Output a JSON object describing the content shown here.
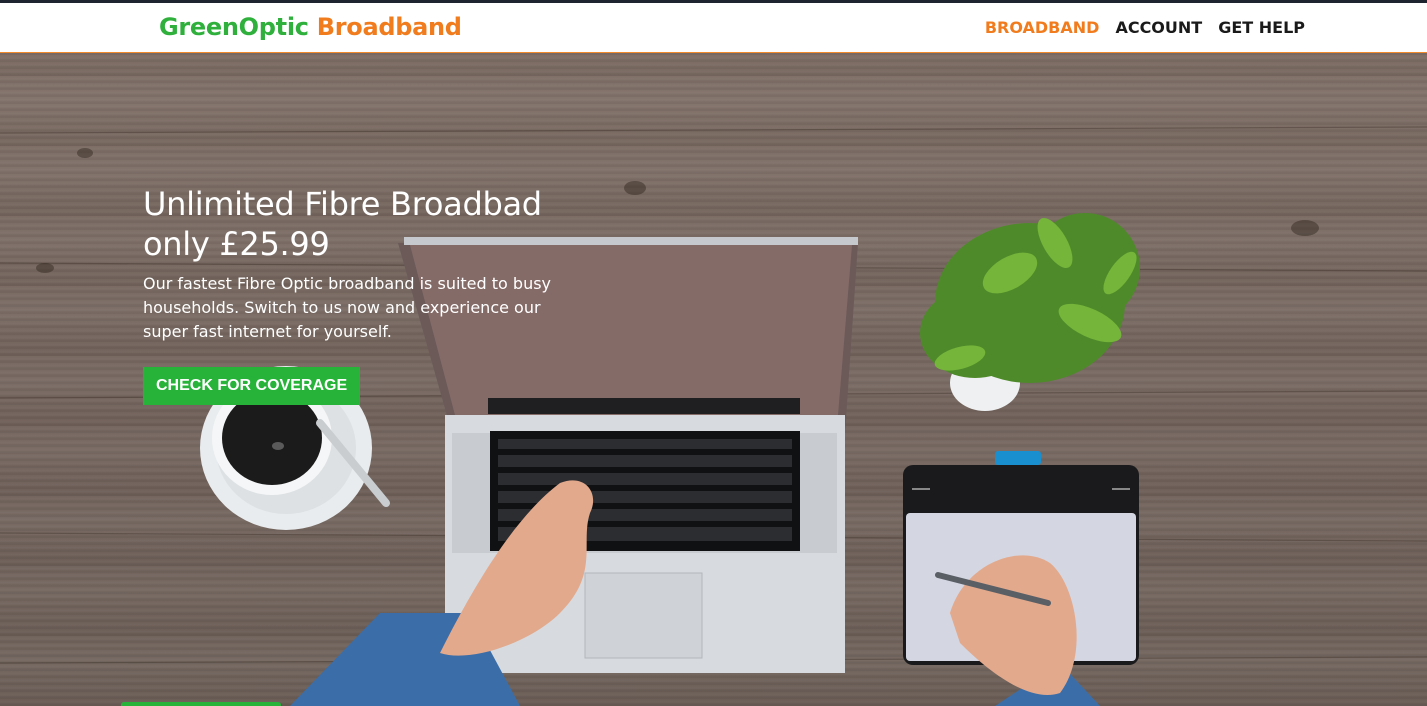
{
  "brand": {
    "part1": "GreenOptic",
    "part2": "Broadband"
  },
  "nav": {
    "items": [
      {
        "label": "BROADBAND",
        "active": true
      },
      {
        "label": "ACCOUNT",
        "active": false
      },
      {
        "label": "GET HELP",
        "active": false
      }
    ]
  },
  "hero": {
    "headline_line1": "Unlimited Fibre Broadbad",
    "headline_line2": "only £25.99",
    "description": "Our fastest Fibre Optic broadband is suited to busy households. Switch to us now and experience our super fast internet for yourself.",
    "cta_label": "CHECK FOR COVERAGE"
  },
  "colors": {
    "green": "#27b33a",
    "orange": "#f07c1e",
    "dark": "#1a1a1a"
  }
}
